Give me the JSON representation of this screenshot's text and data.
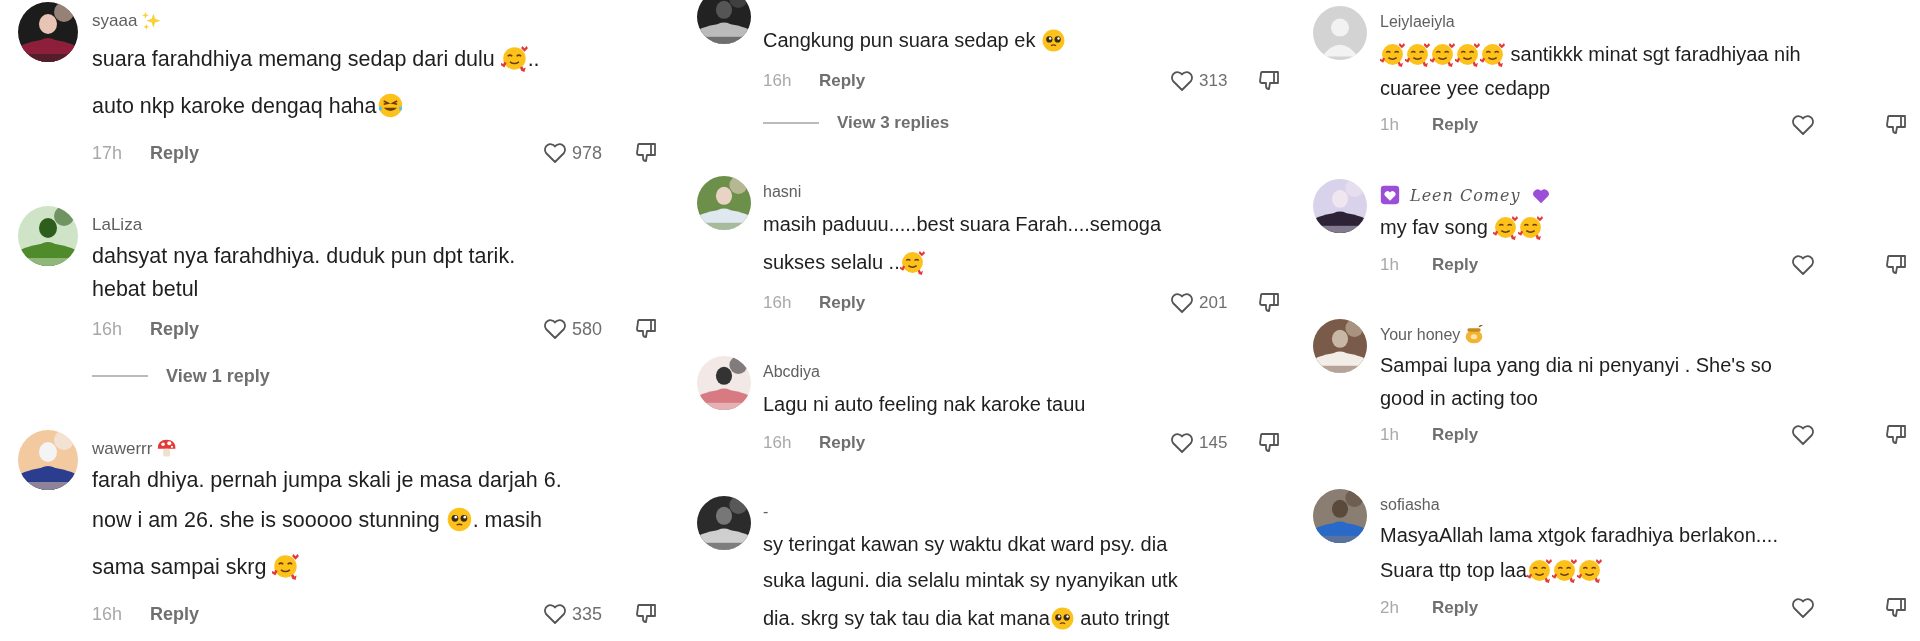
{
  "panels": [
    {
      "comments": [
        {
          "avatar": {
            "kind": "picture"
          },
          "username": [
            {
              "kind": "text",
              "text": "syaaa"
            },
            {
              "kind": "sparkles"
            }
          ],
          "lines": [
            [
              {
                "kind": "text",
                "text": "suara farahdhiya memang sedap dari dulu "
              },
              {
                "kind": "loveface"
              },
              {
                "kind": "text",
                "text": ".."
              }
            ],
            [
              {
                "kind": "text",
                "text": "auto nkp karoke dengaq haha"
              },
              {
                "kind": "laughface"
              }
            ]
          ],
          "time": "17h",
          "reply": "Reply",
          "likes": "978"
        },
        {
          "avatar": {
            "kind": "picture"
          },
          "username": [
            {
              "kind": "text",
              "text": "LaLiza"
            }
          ],
          "lines": [
            [
              {
                "kind": "text",
                "text": "dahsyat nya farahdhiya. duduk pun dpt tarik."
              }
            ],
            [
              {
                "kind": "text",
                "text": "hebat betul"
              }
            ]
          ],
          "time": "16h",
          "reply": "Reply",
          "likes": "580",
          "view_replies": "View 1 reply"
        },
        {
          "avatar": {
            "kind": "picture"
          },
          "username": [
            {
              "kind": "text",
              "text": "wawerrr"
            },
            {
              "kind": "mushroom"
            }
          ],
          "lines": [
            [
              {
                "kind": "text",
                "text": "farah dhiya. pernah jumpa skali je masa darjah 6."
              }
            ],
            [
              {
                "kind": "text",
                "text": "now i am 26. she is sooooo stunning "
              },
              {
                "kind": "pleadface"
              },
              {
                "kind": "text",
                "text": ". masih"
              }
            ],
            [
              {
                "kind": "text",
                "text": "sama sampai skrg "
              },
              {
                "kind": "loveface"
              }
            ]
          ],
          "time": "16h",
          "reply": "Reply",
          "likes": "335"
        }
      ]
    },
    {
      "comments": [
        {
          "avatar": {
            "kind": "picture"
          },
          "lines": [
            [
              {
                "kind": "text",
                "text": "Cangkung pun suara sedap ek "
              },
              {
                "kind": "pleadface"
              }
            ]
          ],
          "time": "16h",
          "reply": "Reply",
          "likes": "313",
          "view_replies": "View 3 replies"
        },
        {
          "avatar": {
            "kind": "picture"
          },
          "username": [
            {
              "kind": "text",
              "text": "hasni"
            }
          ],
          "lines": [
            [
              {
                "kind": "text",
                "text": "masih paduuu.....best suara Farah....semoga"
              }
            ],
            [
              {
                "kind": "text",
                "text": "sukses selalu .."
              },
              {
                "kind": "loveface"
              }
            ]
          ],
          "time": "16h",
          "reply": "Reply",
          "likes": "201"
        },
        {
          "avatar": {
            "kind": "picture"
          },
          "username": [
            {
              "kind": "text",
              "text": "Abcdiya"
            }
          ],
          "lines": [
            [
              {
                "kind": "text",
                "text": "Lagu ni auto feeling nak karoke tauu"
              }
            ]
          ],
          "time": "16h",
          "reply": "Reply",
          "likes": "145"
        },
        {
          "avatar": {
            "kind": "picture"
          },
          "username": [
            {
              "kind": "text",
              "text": "-"
            }
          ],
          "lines": [
            [
              {
                "kind": "text",
                "text": "sy teringat kawan sy waktu dkat ward psy. dia"
              }
            ],
            [
              {
                "kind": "text",
                "text": "suka laguni. dia selalu mintak sy nyanyikan utk"
              }
            ],
            [
              {
                "kind": "text",
                "text": "dia. skrg sy tak tau dia kat mana"
              },
              {
                "kind": "pleadface"
              },
              {
                "kind": "text",
                "text": " auto tringt"
              }
            ]
          ]
        }
      ]
    },
    {
      "comments": [
        {
          "avatar": {
            "kind": "default"
          },
          "username": [
            {
              "kind": "text",
              "text": "Leiylaeiyla"
            }
          ],
          "lines": [
            [
              {
                "kind": "loveface"
              },
              {
                "kind": "loveface"
              },
              {
                "kind": "loveface"
              },
              {
                "kind": "loveface"
              },
              {
                "kind": "loveface"
              },
              {
                "kind": "text",
                "text": " santikkk minat sgt faradhiyaa nih"
              }
            ],
            [
              {
                "kind": "text",
                "text": "cuaree yee cedapp"
              }
            ]
          ],
          "time": "1h",
          "reply": "Reply"
        },
        {
          "avatar": {
            "kind": "picture"
          },
          "username": [
            {
              "kind": "heartbox"
            },
            {
              "kind": "script",
              "text": "Leen Comey"
            },
            {
              "kind": "purpleheart"
            }
          ],
          "lines": [
            [
              {
                "kind": "text",
                "text": "my fav song "
              },
              {
                "kind": "loveface"
              },
              {
                "kind": "loveface"
              }
            ]
          ],
          "time": "1h",
          "reply": "Reply"
        },
        {
          "avatar": {
            "kind": "picture"
          },
          "username": [
            {
              "kind": "text",
              "text": "Your honey"
            },
            {
              "kind": "honeypot"
            }
          ],
          "lines": [
            [
              {
                "kind": "text",
                "text": "Sampai lupa yang dia ni penyanyi . She's so"
              }
            ],
            [
              {
                "kind": "text",
                "text": "good in acting too"
              }
            ]
          ],
          "time": "1h",
          "reply": "Reply"
        },
        {
          "avatar": {
            "kind": "picture"
          },
          "username": [
            {
              "kind": "text",
              "text": "sofiasha"
            }
          ],
          "lines": [
            [
              {
                "kind": "text",
                "text": "MasyaAllah lama xtgok faradhiya berlakon...."
              }
            ],
            [
              {
                "kind": "text",
                "text": "Suara ttp top laa"
              },
              {
                "kind": "loveface"
              },
              {
                "kind": "loveface"
              },
              {
                "kind": "loveface"
              }
            ]
          ],
          "time": "2h",
          "reply": "Reply"
        }
      ]
    }
  ]
}
